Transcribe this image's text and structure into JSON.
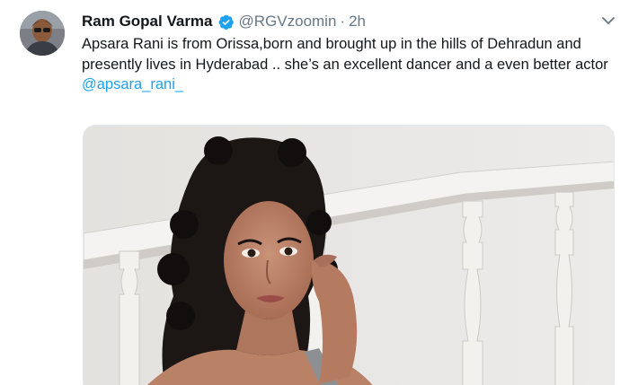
{
  "author": {
    "display_name": "Ram Gopal Varma",
    "handle": "@RGVzoomin",
    "separator": "·",
    "time_ago": "2h",
    "verified_icon": "verified-badge-icon"
  },
  "tweet": {
    "body": "Apsara Rani is from Orissa,born and brought up in the hills of Dehradun and presently lives in Hyderabad .. she’s an excellent dancer and a even better actor",
    "mention": "@apsara_rani_"
  },
  "menu": {
    "icon": "chevron-down-icon"
  },
  "colors": {
    "accent": "#1da1f2",
    "secondary_text": "#657786",
    "primary_text": "#14171a"
  }
}
